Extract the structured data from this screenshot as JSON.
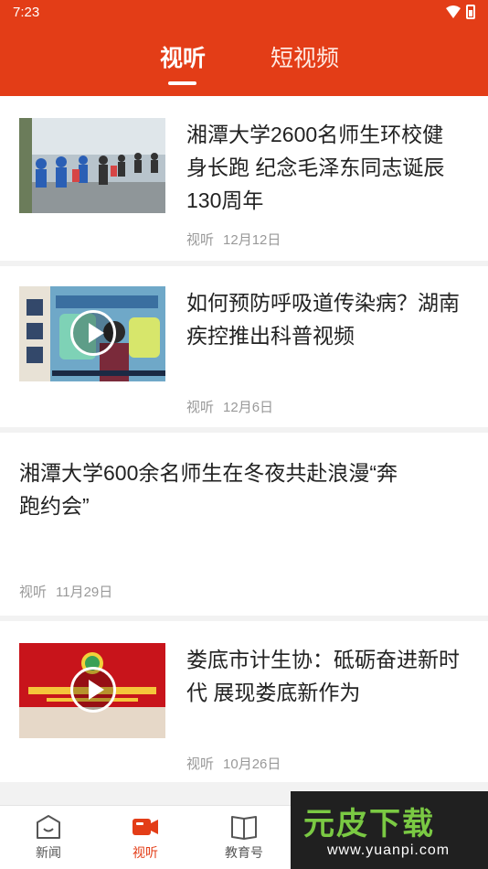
{
  "status_bar": {
    "time": "7:23"
  },
  "header": {
    "tabs": [
      {
        "label": "视听",
        "active": true
      },
      {
        "label": "短视频",
        "active": false
      }
    ],
    "background_color": "#e33d17"
  },
  "feed": [
    {
      "title": "湘潭大学2600名师生环校健身长跑 纪念毛泽东同志诞辰130周年",
      "source": "视听",
      "date": "12月12日",
      "has_thumbnail": true,
      "has_play_icon": false
    },
    {
      "title": "如何预防呼吸道传染病？湖南疾控推出科普视频",
      "source": "视听",
      "date": "12月6日",
      "has_thumbnail": true,
      "has_play_icon": true
    },
    {
      "title": "湘潭大学600余名师生在冬夜共赴浪漫“奔跑约会”",
      "source": "视听",
      "date": "11月29日",
      "has_thumbnail": false,
      "has_play_icon": false
    },
    {
      "title": "娄底市计生协：砥砺奋进新时代 展现娄底新作为",
      "source": "视听",
      "date": "10月26日",
      "has_thumbnail": true,
      "has_play_icon": true
    }
  ],
  "bottom_nav": [
    {
      "label": "新闻",
      "icon": "news-icon",
      "active": false
    },
    {
      "label": "视听",
      "icon": "video-camera-icon",
      "active": true
    },
    {
      "label": "教育号",
      "icon": "book-icon",
      "active": false
    }
  ],
  "watermark": {
    "text": "元皮下载",
    "url": "www.yuanpi.com"
  }
}
